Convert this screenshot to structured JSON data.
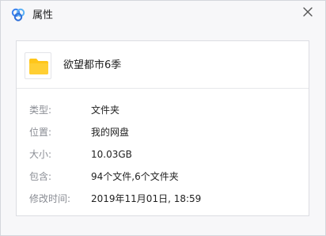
{
  "window": {
    "title": "属性",
    "app_icon": "baidu-netdisk-cloud-icon",
    "close_icon": "close-icon"
  },
  "file": {
    "icon": "folder-icon",
    "name": "欲望都市6季"
  },
  "properties": [
    {
      "label": "类型:",
      "value": "文件夹"
    },
    {
      "label": "位置:",
      "value": "我的网盘"
    },
    {
      "label": "大小:",
      "value": "10.03GB"
    },
    {
      "label": "包含:",
      "value": "94个文件,6个文件夹"
    },
    {
      "label": "修改时间:",
      "value": "2019年11月01日, 18:59"
    }
  ],
  "colors": {
    "folder": "#ffc61a",
    "icon_blue": "#3a82f0",
    "label_gray": "#8a8d94"
  }
}
